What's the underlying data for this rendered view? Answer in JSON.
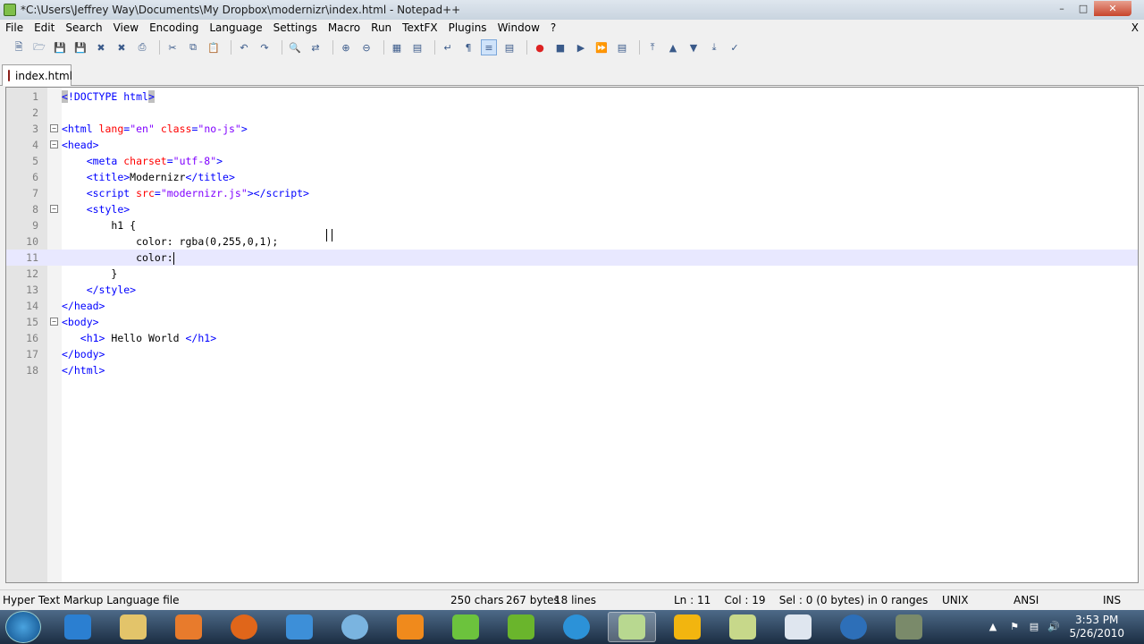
{
  "window": {
    "title": "*C:\\Users\\Jeffrey Way\\Documents\\My Dropbox\\modernizr\\index.html - Notepad++"
  },
  "menu": [
    "File",
    "Edit",
    "Search",
    "View",
    "Encoding",
    "Language",
    "Settings",
    "Macro",
    "Run",
    "TextFX",
    "Plugins",
    "Window",
    "?"
  ],
  "menu_close": "X",
  "tab": {
    "label": "index.html"
  },
  "editor": {
    "line_numbers": [
      "1",
      "2",
      "3",
      "4",
      "5",
      "6",
      "7",
      "8",
      "9",
      "10",
      "11",
      "12",
      "13",
      "14",
      "15",
      "16",
      "17",
      "18"
    ],
    "current_line": 11
  },
  "status": {
    "filetype": "Hyper Text Markup Language file",
    "chars": "250 chars",
    "bytes": "267 bytes",
    "lines": "18 lines",
    "position": "Ln : 11    Col : 19    Sel : 0 (0 bytes) in 0 ranges",
    "eol": "UNIX",
    "encoding": "ANSI",
    "mode": "INS"
  },
  "taskbar": {
    "time": "3:53 PM",
    "date": "5/26/2010"
  },
  "colors": {
    "tag": "#0000ff",
    "attr": "#ff0000",
    "string": "#8000ff",
    "current_line": "#e8e8ff"
  }
}
